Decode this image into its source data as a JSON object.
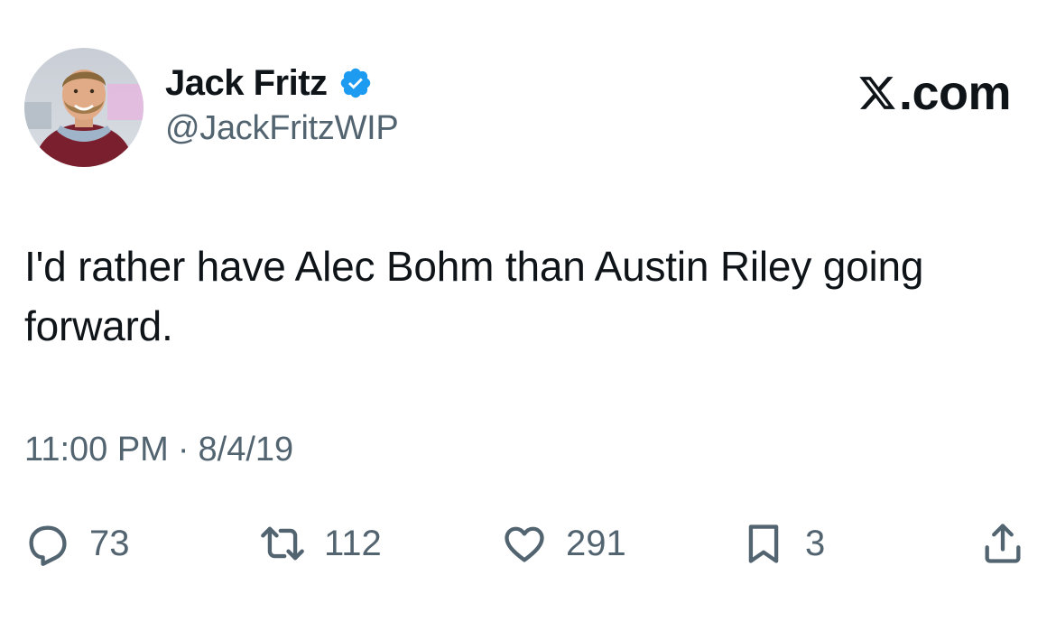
{
  "author": {
    "display_name": "Jack Fritz",
    "handle": "@JackFritzWIP",
    "verified": true,
    "verified_color": "#1d9bf0"
  },
  "brand": {
    "label": ".com",
    "icon": "x-logo-icon"
  },
  "tweet": {
    "text": "I'd rather have Alec Bohm than Austin Riley going forward.",
    "time": "11:00 PM",
    "separator": "·",
    "date": "8/4/19"
  },
  "actions": {
    "reply": {
      "icon": "reply-icon",
      "count": "73"
    },
    "retweet": {
      "icon": "retweet-icon",
      "count": "112"
    },
    "like": {
      "icon": "heart-icon",
      "count": "291"
    },
    "bookmark": {
      "icon": "bookmark-icon",
      "count": "3"
    },
    "share": {
      "icon": "share-icon"
    }
  },
  "colors": {
    "text_primary": "#0f1419",
    "text_secondary": "#536471",
    "background": "#ffffff"
  }
}
